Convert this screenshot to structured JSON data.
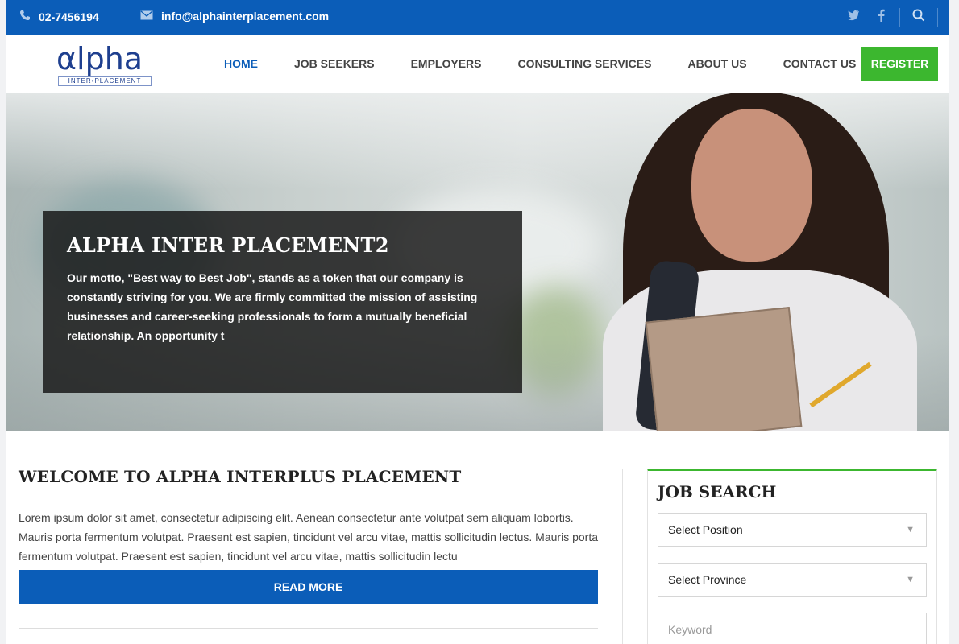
{
  "topbar": {
    "phone": "02-7456194",
    "email": "info@alphainterplacement.com",
    "icons": [
      "phone-icon",
      "mail-icon",
      "twitter-icon",
      "facebook-icon",
      "search-icon"
    ]
  },
  "logo": {
    "word": "αlpha",
    "sub": "INTER•PLACEMENT"
  },
  "nav": {
    "items": [
      "HOME",
      "JOB SEEKERS",
      "EMPLOYERS",
      "CONSULTING SERVICES",
      "ABOUT US",
      "CONTACT US"
    ],
    "active": "HOME",
    "register_label": "REGISTER"
  },
  "hero": {
    "title": "ALPHA INTER PLACEMENT2",
    "text": "Our motto, \"Best way to Best Job\", stands as a token that our company is constantly striving for you. We are firmly committed the mission of assisting businesses and career-seeking professionals to form a mutually beneficial relationship. An opportunity t"
  },
  "welcome": {
    "title": "WELCOME TO ALPHA INTERPLUS PLACEMENT",
    "text": "Lorem ipsum dolor sit amet, consectetur adipiscing elit. Aenean consectetur ante volutpat sem aliquam lobortis. Mauris porta fermentum volutpat. Praesent est sapien, tincidunt vel arcu vitae, mattis sollicitudin lectus. Mauris porta fermentum volutpat. Praesent est sapien, tincidunt vel arcu vitae, mattis sollicitudin lectu",
    "read_more": "READ MORE"
  },
  "job_search": {
    "title": "JOB SEARCH",
    "position_placeholder": "Select Position",
    "province_placeholder": "Select Province",
    "keyword_placeholder": "Keyword"
  },
  "colors": {
    "primary": "#0b5db8",
    "accent": "#3cb72f"
  }
}
